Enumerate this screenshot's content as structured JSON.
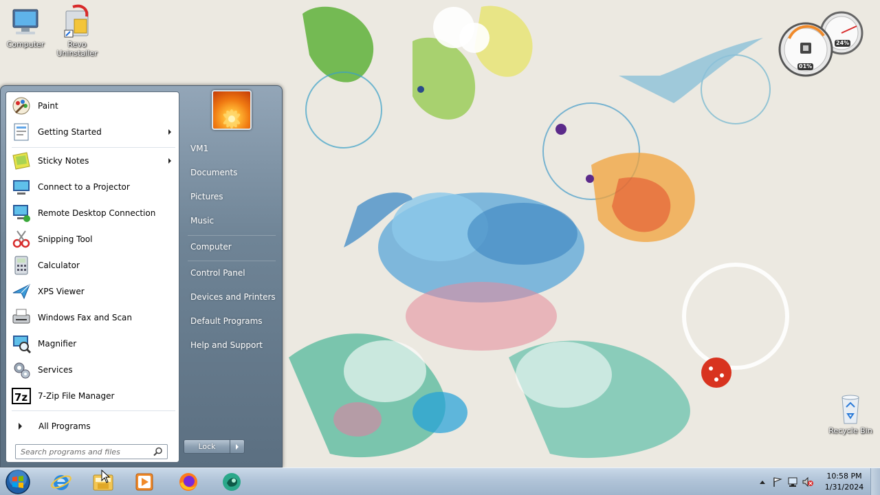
{
  "desktop": {
    "icons": [
      {
        "label": "Computer"
      },
      {
        "label": "Revo Uninstaller"
      },
      {
        "label": "Recycle Bin"
      }
    ],
    "gadget": {
      "cpu_value": "01%",
      "memory_value": "24%"
    }
  },
  "start_menu": {
    "programs": [
      {
        "label": "Paint",
        "icon": "paint-icon",
        "has_submenu": false
      },
      {
        "label": "Getting Started",
        "icon": "getting-started-icon",
        "has_submenu": true
      },
      {
        "label": "Sticky Notes",
        "icon": "sticky-notes-icon",
        "has_submenu": true
      },
      {
        "label": "Connect to a Projector",
        "icon": "projector-icon",
        "has_submenu": false
      },
      {
        "label": "Remote Desktop Connection",
        "icon": "remote-desktop-icon",
        "has_submenu": false
      },
      {
        "label": "Snipping Tool",
        "icon": "snipping-tool-icon",
        "has_submenu": false
      },
      {
        "label": "Calculator",
        "icon": "calculator-icon",
        "has_submenu": false
      },
      {
        "label": "XPS Viewer",
        "icon": "xps-viewer-icon",
        "has_submenu": false
      },
      {
        "label": "Windows Fax and Scan",
        "icon": "fax-scan-icon",
        "has_submenu": false
      },
      {
        "label": "Magnifier",
        "icon": "magnifier-icon",
        "has_submenu": false
      },
      {
        "label": "Services",
        "icon": "services-icon",
        "has_submenu": false
      },
      {
        "label": "7-Zip File Manager",
        "icon": "seven-zip-icon",
        "has_submenu": false
      }
    ],
    "all_programs_label": "All Programs",
    "search_placeholder": "Search programs and files",
    "right_links": [
      {
        "label": "VM1"
      },
      {
        "label": "Documents"
      },
      {
        "label": "Pictures"
      },
      {
        "label": "Music"
      },
      {
        "label": "Computer"
      },
      {
        "label": "Control Panel"
      },
      {
        "label": "Devices and Printers"
      },
      {
        "label": "Default Programs"
      },
      {
        "label": "Help and Support"
      }
    ],
    "lock_label": "Lock"
  },
  "taskbar": {
    "pinned": [
      {
        "icon": "internet-explorer-icon"
      },
      {
        "icon": "file-explorer-icon"
      },
      {
        "icon": "media-player-icon"
      },
      {
        "icon": "firefox-icon"
      },
      {
        "icon": "app-icon"
      }
    ],
    "clock": {
      "time": "10:58 PM",
      "date": "1/31/2024"
    }
  },
  "colors": {
    "taskbar": "#b1c4d8",
    "start_menu_right": "#6f8496",
    "menu_left_bg": "#ffffff"
  }
}
